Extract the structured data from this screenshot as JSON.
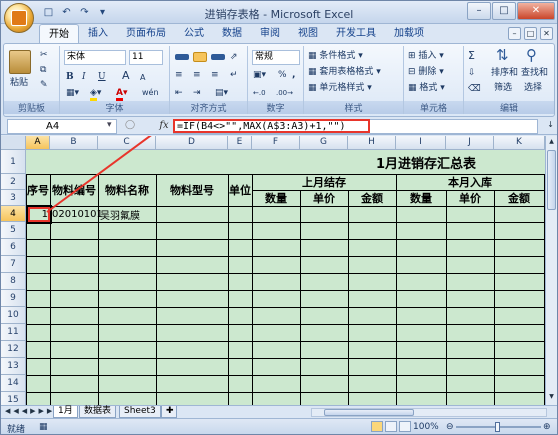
{
  "window": {
    "title": "进销存表格 - Microsoft Excel"
  },
  "ribbon_tabs": [
    "开始",
    "插入",
    "页面布局",
    "公式",
    "数据",
    "审阅",
    "视图",
    "开发工具",
    "加载项"
  ],
  "ribbon": {
    "clipboard": {
      "paste": "粘贴",
      "label": "剪贴板"
    },
    "font": {
      "name": "宋体",
      "size": "11",
      "bold": "B",
      "italic": "I",
      "underline": "U",
      "grow": "A",
      "shrink": "A",
      "wen": "wén",
      "label": "字体"
    },
    "alignment": {
      "label": "对齐方式"
    },
    "number": {
      "format": "常规",
      "percent": "%",
      "comma": ",",
      "label": "数字"
    },
    "styles": {
      "conditional": "条件格式",
      "table": "套用表格格式",
      "cell": "单元格样式",
      "label": "样式"
    },
    "cells": {
      "insert": "插入",
      "delete": "删除",
      "format": "格式",
      "label": "单元格"
    },
    "editing": {
      "sigma": "Σ",
      "sort": "排序和",
      "sort2": "筛选",
      "find": "查找和",
      "find2": "选择",
      "label": "编辑"
    }
  },
  "formula_bar": {
    "name_box": "A4",
    "fx": "fx",
    "formula": "=IF(B4<>\"\",MAX(A$3:A3)+1,\"\")"
  },
  "columns": [
    "A",
    "B",
    "C",
    "D",
    "E",
    "F",
    "G",
    "H",
    "I",
    "J",
    "K"
  ],
  "rows": [
    "1",
    "2",
    "3",
    "4",
    "5",
    "6",
    "7",
    "8",
    "9",
    "10",
    "11",
    "12",
    "13",
    "14",
    "15",
    "16"
  ],
  "sheet": {
    "title": "1月进销存汇总表",
    "h_seq": "序号",
    "h_code": "物料编号",
    "h_name": "物料名称",
    "h_model": "物料型号",
    "h_unit": "单位",
    "h_prev": "上月结存",
    "h_in": "本月入库",
    "h_qty1": "数量",
    "h_price1": "单价",
    "h_amt1": "金额",
    "h_qty2": "数量",
    "h_price2": "单价",
    "h_amt2": "金额",
    "r4_seq": "1",
    "r4_code": "02010101",
    "r4_name": "吴羽氟膜"
  },
  "sheet_tabs": [
    "1月",
    "数据表",
    "Sheet3"
  ],
  "status": {
    "ready": "就绪",
    "zoom": "100%"
  },
  "colors": {
    "grid_fill": "#cce8cf",
    "highlight": "#e8352b",
    "selected_header": "#f6c45c"
  }
}
